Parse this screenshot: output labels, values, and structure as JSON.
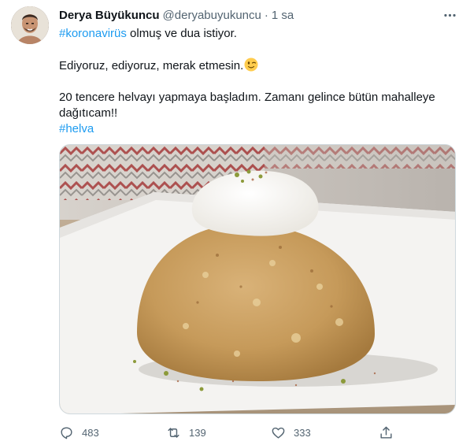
{
  "tweet": {
    "author": {
      "display_name": "Derya Büyükuncu",
      "handle": "@deryabuyukuncu",
      "separator": "·",
      "time": "1 sa"
    },
    "text": {
      "line1_hashtag": "#koronavirüs",
      "line1_rest": " olmuş ve dua istiyor.",
      "line2": "Ediyoruz, ediyoruz, merak etmesin.",
      "line3": "20 tencere helvayı yapmaya başladım. Zamanı gelince bütün mahalleye",
      "line4": "dağıtıcam!!",
      "line5_hashtag": "#helva"
    },
    "emoji": "winking-face",
    "colors": {
      "hashtag": "#1d9bf0",
      "secondary_text": "#536471",
      "primary_text": "#0f1419"
    },
    "actions": {
      "reply_count": "483",
      "retweet_count": "139",
      "like_count": "333",
      "icons": [
        "reply-icon",
        "retweet-icon",
        "heart-icon",
        "share-icon"
      ]
    },
    "more_icon": "more-horizontal-icon",
    "media_subject": "semolina halva dome with kaymak cream and pistachio on a white plate"
  }
}
